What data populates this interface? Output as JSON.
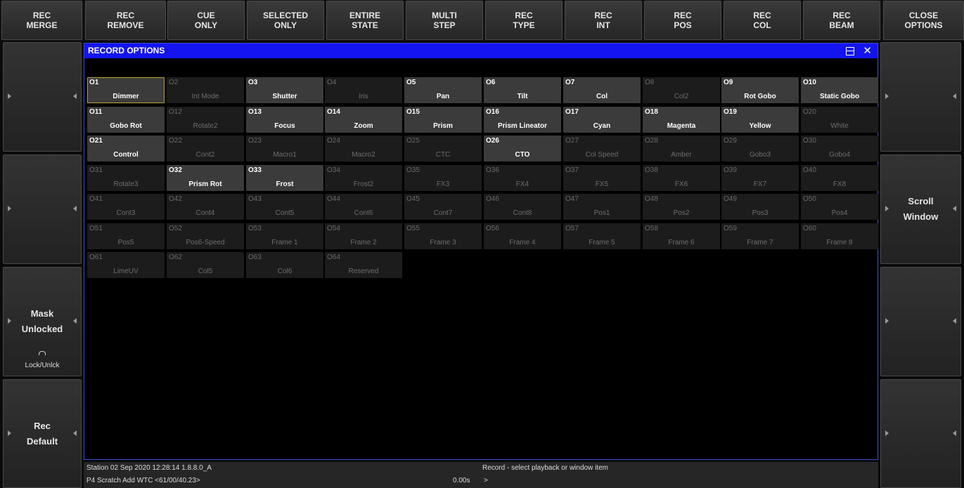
{
  "toolbar": [
    {
      "label": "REC\nMERGE"
    },
    {
      "label": "REC\nREMOVE"
    },
    {
      "label": "CUE\nONLY"
    },
    {
      "label": "SELECTED\nONLY"
    },
    {
      "label": "ENTIRE\nSTATE"
    },
    {
      "label": "MULTI\nSTEP"
    },
    {
      "label": "REC\nTYPE"
    },
    {
      "label": "REC\nINT"
    },
    {
      "label": "REC\nPOS"
    },
    {
      "label": "REC\nCOL"
    },
    {
      "label": "REC\nBEAM"
    },
    {
      "label": "CLOSE\nOPTIONS"
    }
  ],
  "left_side": [
    {
      "label": ""
    },
    {
      "label": ""
    },
    {
      "label": "Mask\nUnlocked",
      "footer": "Lock/Unlck"
    },
    {
      "label": "Rec\nDefault"
    }
  ],
  "right_side": [
    {
      "label": ""
    },
    {
      "label": "Scroll\nWindow"
    },
    {
      "label": ""
    },
    {
      "label": ""
    }
  ],
  "window": {
    "title": "RECORD OPTIONS",
    "restore_icon": "restore-icon",
    "close_icon": "close-icon",
    "close_glyph": "✕"
  },
  "options": [
    {
      "num": "O1",
      "label": "Dimmer",
      "active": true,
      "selected": true
    },
    {
      "num": "O2",
      "label": "Int Mode",
      "active": false
    },
    {
      "num": "O3",
      "label": "Shutter",
      "active": true
    },
    {
      "num": "O4",
      "label": "Iris",
      "active": false
    },
    {
      "num": "O5",
      "label": "Pan",
      "active": true
    },
    {
      "num": "O6",
      "label": "Tilt",
      "active": true
    },
    {
      "num": "O7",
      "label": "Col",
      "active": true
    },
    {
      "num": "O8",
      "label": "Col2",
      "active": false
    },
    {
      "num": "O9",
      "label": "Rot Gobo",
      "active": true
    },
    {
      "num": "O10",
      "label": "Static Gobo",
      "active": true
    },
    {
      "num": "O11",
      "label": "Gobo Rot",
      "active": true
    },
    {
      "num": "O12",
      "label": "Rotate2",
      "active": false
    },
    {
      "num": "O13",
      "label": "Focus",
      "active": true
    },
    {
      "num": "O14",
      "label": "Zoom",
      "active": true
    },
    {
      "num": "O15",
      "label": "Prism",
      "active": true
    },
    {
      "num": "O16",
      "label": "Prism Lineator",
      "active": true
    },
    {
      "num": "O17",
      "label": "Cyan",
      "active": true
    },
    {
      "num": "O18",
      "label": "Magenta",
      "active": true
    },
    {
      "num": "O19",
      "label": "Yellow",
      "active": true
    },
    {
      "num": "O20",
      "label": "White",
      "active": false
    },
    {
      "num": "O21",
      "label": "Control",
      "active": true
    },
    {
      "num": "O22",
      "label": "Cont2",
      "active": false
    },
    {
      "num": "O23",
      "label": "Macro1",
      "active": false
    },
    {
      "num": "O24",
      "label": "Macro2",
      "active": false
    },
    {
      "num": "O25",
      "label": "CTC",
      "active": false
    },
    {
      "num": "O26",
      "label": "CTO",
      "active": true
    },
    {
      "num": "O27",
      "label": "Col Speed",
      "active": false
    },
    {
      "num": "O28",
      "label": "Amber",
      "active": false
    },
    {
      "num": "O29",
      "label": "Gobo3",
      "active": false
    },
    {
      "num": "O30",
      "label": "Gobo4",
      "active": false
    },
    {
      "num": "O31",
      "label": "Rotate3",
      "active": false
    },
    {
      "num": "O32",
      "label": "Prism Rot",
      "active": true
    },
    {
      "num": "O33",
      "label": "Frost",
      "active": true
    },
    {
      "num": "O34",
      "label": "Frost2",
      "active": false
    },
    {
      "num": "O35",
      "label": "FX3",
      "active": false
    },
    {
      "num": "O36",
      "label": "FX4",
      "active": false
    },
    {
      "num": "O37",
      "label": "FX5",
      "active": false
    },
    {
      "num": "O38",
      "label": "FX6",
      "active": false
    },
    {
      "num": "O39",
      "label": "FX7",
      "active": false
    },
    {
      "num": "O40",
      "label": "FX8",
      "active": false
    },
    {
      "num": "O41",
      "label": "Cont3",
      "active": false
    },
    {
      "num": "O42",
      "label": "Cont4",
      "active": false
    },
    {
      "num": "O43",
      "label": "Cont5",
      "active": false
    },
    {
      "num": "O44",
      "label": "Cont6",
      "active": false
    },
    {
      "num": "O45",
      "label": "Cont7",
      "active": false
    },
    {
      "num": "O46",
      "label": "Cont8",
      "active": false
    },
    {
      "num": "O47",
      "label": "Pos1",
      "active": false
    },
    {
      "num": "O48",
      "label": "Pos2",
      "active": false
    },
    {
      "num": "O49",
      "label": "Pos3",
      "active": false
    },
    {
      "num": "O50",
      "label": "Pos4",
      "active": false
    },
    {
      "num": "O51",
      "label": "Pos5",
      "active": false
    },
    {
      "num": "O52",
      "label": "Pos6-Speed",
      "active": false
    },
    {
      "num": "O53",
      "label": "Frame 1",
      "active": false
    },
    {
      "num": "O54",
      "label": "Frame 2",
      "active": false
    },
    {
      "num": "O55",
      "label": "Frame 3",
      "active": false
    },
    {
      "num": "O56",
      "label": "Frame 4",
      "active": false
    },
    {
      "num": "O57",
      "label": "Frame 5",
      "active": false
    },
    {
      "num": "O58",
      "label": "Frame 6",
      "active": false
    },
    {
      "num": "O59",
      "label": "Frame 7",
      "active": false
    },
    {
      "num": "O60",
      "label": "Frame 8",
      "active": false
    },
    {
      "num": "O61",
      "label": "LimeUV",
      "active": false
    },
    {
      "num": "O62",
      "label": "Col5",
      "active": false
    },
    {
      "num": "O63",
      "label": "Col6",
      "active": false
    },
    {
      "num": "O64",
      "label": "Reserved",
      "active": false
    }
  ],
  "status": {
    "line1_left": "Station 02 Sep 2020 12:28:14 1.8.8.0_A",
    "line1_right": "Record - select playback or window item",
    "line2_left": "P4 Scratch  Add  WTC <61/00/40.23>",
    "line2_time": "0.00s",
    "line2_prompt": ">"
  },
  "colors": {
    "title_bar": "#1414f0",
    "selected_border": "#b7a23a",
    "active_cell": "#3b3b3b",
    "inactive_cell": "#1c1c1c"
  }
}
